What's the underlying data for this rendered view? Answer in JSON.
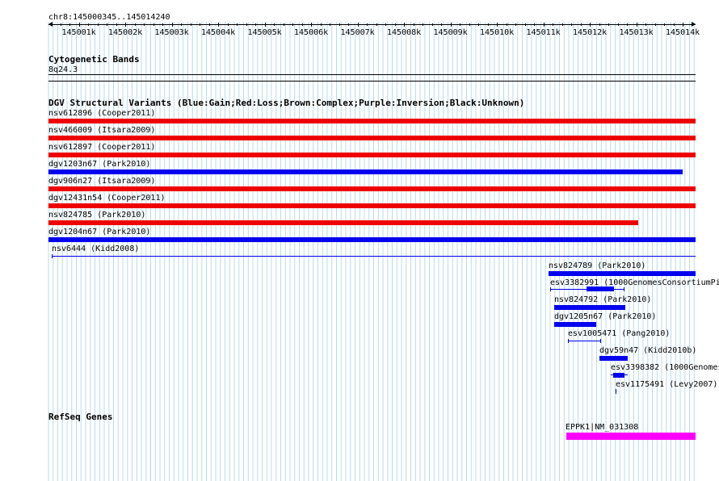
{
  "ruler": {
    "position_label": "chr8:145000345..145014240",
    "ticks": [
      "145001k",
      "145002k",
      "145003k",
      "145004k",
      "145005k",
      "145006k",
      "145007k",
      "145008k",
      "145009k",
      "145010k",
      "145011k",
      "145012k",
      "145013k",
      "145014k"
    ]
  },
  "cytoband": {
    "title": "Cytogenetic Bands",
    "band_label": "8q24.3"
  },
  "dgv": {
    "title": "DGV Structural Variants (Blue:Gain;Red:Loss;Brown:Complex;Purple:Inversion;Black:Unknown)",
    "colors": {
      "gain": "#0000ee",
      "loss": "#ee0000",
      "unknown": "#0000ee"
    },
    "variants": [
      {
        "label": "nsv612896 (Cooper2011)"
      },
      {
        "label": "nsv466009 (Itsara2009)"
      },
      {
        "label": "nsv612897 (Cooper2011)"
      },
      {
        "label": "dgv1203n67 (Park2010)"
      },
      {
        "label": "dgv906n27 (Itsara2009)"
      },
      {
        "label": "dgv12431n54 (Cooper2011)"
      },
      {
        "label": "nsv824785 (Park2010)"
      },
      {
        "label": "dgv1204n67 (Park2010)"
      },
      {
        "label": "nsv6444 (Kidd2008)"
      },
      {
        "label": "nsv824789 (Park2010)"
      },
      {
        "label": "esv3382991 (1000GenomesConsortiumPi"
      },
      {
        "label": "nsv824792 (Park2010)"
      },
      {
        "label": "dgv1205n67 (Park2010)"
      },
      {
        "label": "esv1005471 (Pang2010)"
      },
      {
        "label": "dgv59n47 (Kidd2010b)"
      },
      {
        "label": "esv3398382 (1000Genomes"
      },
      {
        "label": "esv1175491 (Levy2007)"
      }
    ]
  },
  "refseq": {
    "title": "RefSeq Genes",
    "genes": [
      {
        "label": "EPPK1|NM_031308",
        "color": "#ff00ff"
      }
    ]
  }
}
